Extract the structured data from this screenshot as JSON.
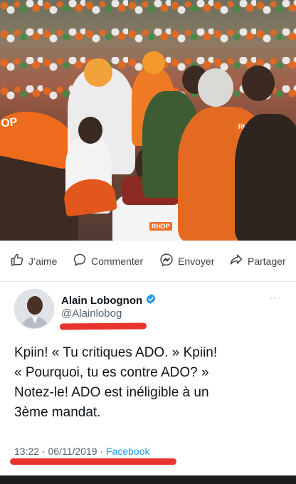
{
  "actions": {
    "like": "J’aime",
    "comment": "Commenter",
    "send": "Envoyer",
    "share": "Partager"
  },
  "tweet": {
    "author_name": "Alain Lobognon",
    "handle": "@Alainlobog",
    "text_line1": "Kpiin! « Tu critiques ADO. » Kpiin!",
    "text_line2": "« Pourquoi, tu es contre ADO? »",
    "text_line3": "Notez-le! ADO est inéligible à un",
    "text_line4": "3ème mandat.",
    "time": "13:22",
    "date": "06/11/2019",
    "source": "Facebook",
    "separator": " · "
  },
  "photo": {
    "cap_text": "OP",
    "badge_text": "RHDP"
  },
  "colors": {
    "accent_blue": "#1d9bf0",
    "annotation_red": "#e8332e",
    "party_orange": "#ee6a1c"
  },
  "icons": {
    "like": "thumbs-up-icon",
    "comment": "speech-bubble-icon",
    "send": "messenger-icon",
    "share": "share-arrow-icon",
    "verified": "verified-badge-icon",
    "more": "more-dots-icon"
  }
}
